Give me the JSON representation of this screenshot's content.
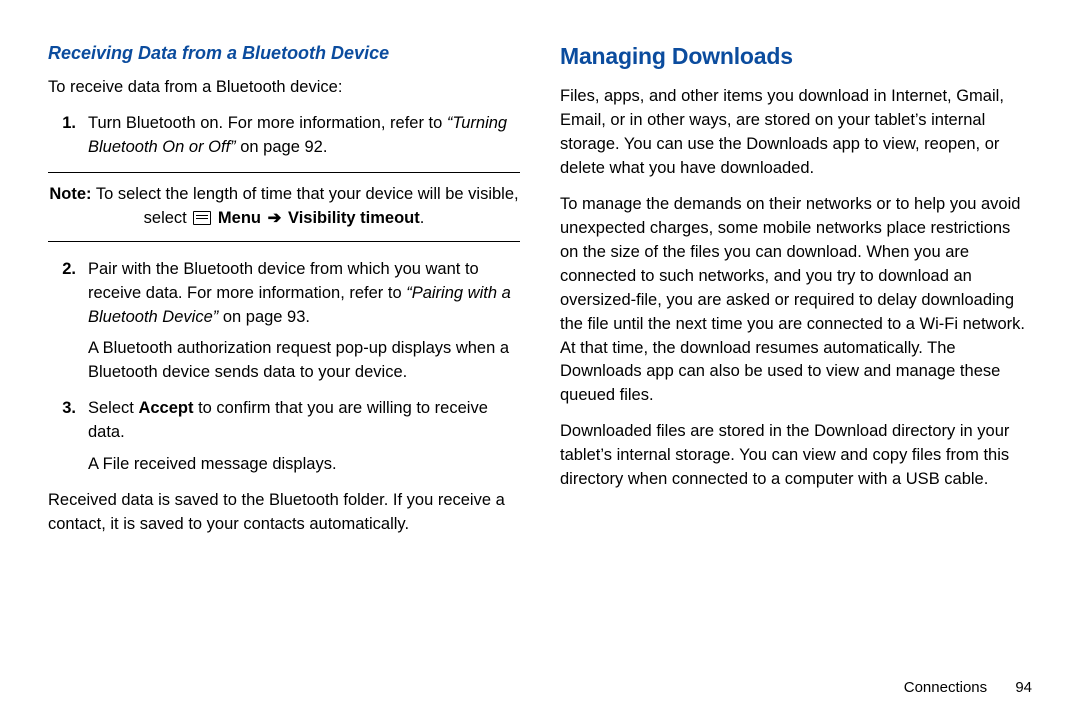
{
  "left": {
    "heading": "Receiving Data from a Bluetooth Device",
    "intro": "To receive data from a Bluetooth device:",
    "step1_a": "Turn Bluetooth on. For more information, refer to ",
    "step1_ref": "“Turning Bluetooth On or Off”",
    "step1_b": " on page 92.",
    "note_a": "Note:",
    "note_b": " To select the length of time that your device will be visible, select ",
    "note_menu": " Menu ",
    "note_arrow": "➔",
    "note_vis": " Visibility timeout",
    "note_dot": ".",
    "step2_a": "Pair with the Bluetooth device from which you want to receive data. For more information, refer to ",
    "step2_ref": "“Pairing with a Bluetooth Device”",
    "step2_b": " on page 93.",
    "step2_p2": "A Bluetooth authorization request pop-up displays when a Bluetooth device sends data to your device.",
    "step3_a": "Select ",
    "step3_accept": "Accept",
    "step3_b": " to confirm that you are willing to receive data.",
    "step3_p2": "A File received message displays.",
    "outro": "Received data is saved to the Bluetooth folder. If you receive a contact, it is saved to your contacts automatically."
  },
  "right": {
    "heading": "Managing Downloads",
    "p1": "Files, apps, and other items you download in Internet, Gmail, Email, or in other ways, are stored on your tablet’s internal storage. You can use the Downloads app to view, reopen, or delete what you have downloaded.",
    "p2": "To manage the demands on their networks or to help you avoid unexpected charges, some mobile networks place restrictions on the size of the files you can download. When you are connected to such networks, and you try to download an oversized-file, you are asked or required to delay downloading the file until the next time you are connected to a Wi-Fi network. At that time, the download resumes automatically. The Downloads app can also be used to view and manage these queued files.",
    "p3": "Downloaded files are stored in the Download directory in your tablet’s internal storage. You can view and copy files from this directory when connected to a computer with a USB cable."
  },
  "footer": {
    "section": "Connections",
    "page": "94"
  },
  "nums": {
    "one": "1.",
    "two": "2.",
    "three": "3."
  }
}
